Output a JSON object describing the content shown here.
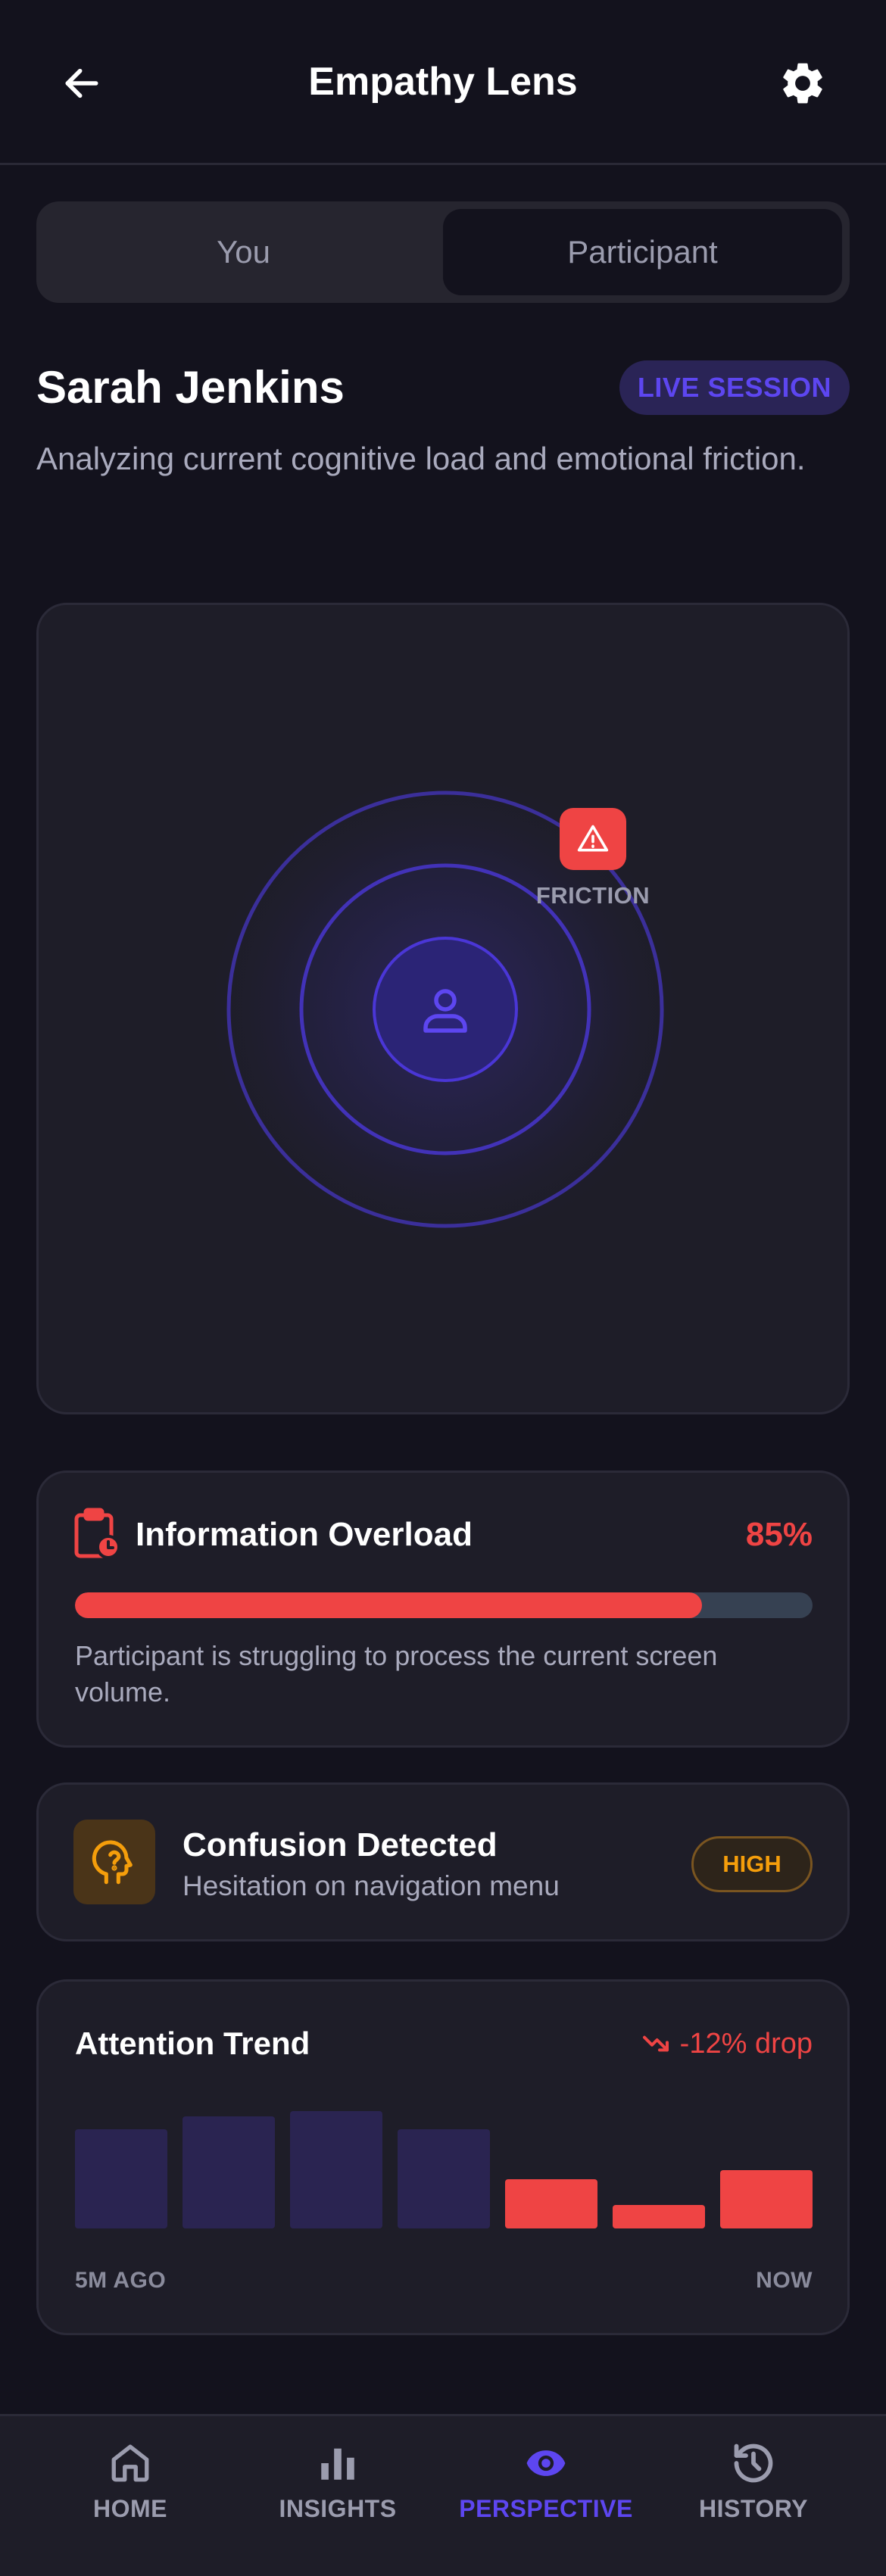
{
  "header": {
    "title": "Empathy Lens",
    "back_icon": "arrow-left-icon",
    "settings_icon": "gear-icon"
  },
  "segment": {
    "options": [
      "You",
      "Participant"
    ],
    "selected": "Participant"
  },
  "participant": {
    "name": "Sarah Jenkins",
    "badge": "LIVE SESSION",
    "description": "Analyzing current cognitive load and emotional friction."
  },
  "visualization": {
    "center_icon": "user-icon",
    "marker_icon": "warning-triangle-icon",
    "marker_label": "FRICTION"
  },
  "overload": {
    "icon": "clipboard-clock-icon",
    "title": "Information Overload",
    "percent_label": "85%",
    "level": 0.85,
    "description": "Participant is struggling to process the current screen volume."
  },
  "confusion": {
    "icon": "head-question-icon",
    "title": "Confusion Detected",
    "subtitle": "Hesitation on navigation menu",
    "severity": "HIGH"
  },
  "attention": {
    "title": "Attention Trend",
    "trend_icon": "trending-down-icon",
    "trend_label": "-12% drop",
    "start_label": "5M AGO",
    "end_label": "NOW",
    "bars": [
      {
        "value": 0.76,
        "state": "normal"
      },
      {
        "value": 0.86,
        "state": "normal"
      },
      {
        "value": 0.9,
        "state": "normal"
      },
      {
        "value": 0.76,
        "state": "normal"
      },
      {
        "value": 0.38,
        "state": "alert"
      },
      {
        "value": 0.18,
        "state": "alert"
      },
      {
        "value": 0.45,
        "state": "alert"
      }
    ]
  },
  "colors": {
    "accent": "#5d46f0",
    "alert": "#ef4444",
    "warning": "#f59e0b",
    "bar_normal": "#2a2451"
  },
  "nav": {
    "items": [
      {
        "label": "HOME",
        "icon": "home-icon"
      },
      {
        "label": "INSIGHTS",
        "icon": "bar-chart-icon"
      },
      {
        "label": "PERSPECTIVE",
        "icon": "eye-icon"
      },
      {
        "label": "HISTORY",
        "icon": "history-icon"
      }
    ],
    "active": "PERSPECTIVE"
  }
}
